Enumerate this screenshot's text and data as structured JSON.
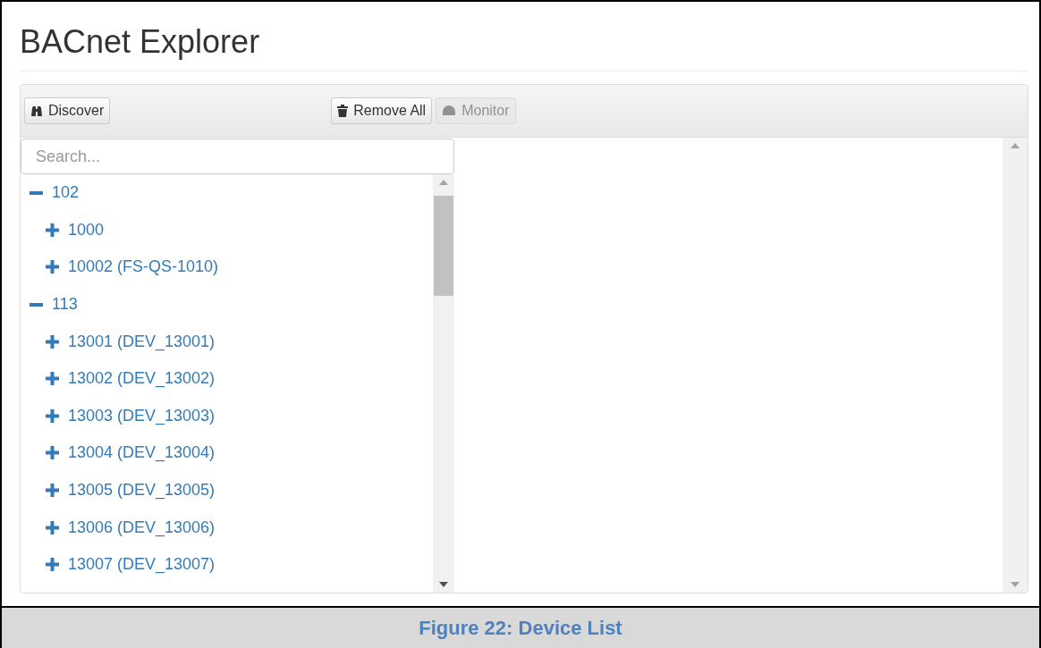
{
  "page_title": "BACnet Explorer",
  "toolbar": {
    "left": [
      {
        "label": "Discover",
        "kind": "binoculars",
        "disabled": false
      }
    ],
    "right": [
      {
        "label": "Remove All",
        "kind": "trash",
        "disabled": false
      },
      {
        "label": "Monitor",
        "kind": "gauge",
        "disabled": true
      }
    ]
  },
  "search": {
    "placeholder": "Search..."
  },
  "tree": [
    {
      "label": "102",
      "expanded": true,
      "children": [
        {
          "label": "1000",
          "expanded": false
        },
        {
          "label": "10002 (FS-QS-1010)",
          "expanded": false
        }
      ]
    },
    {
      "label": "113",
      "expanded": true,
      "children": [
        {
          "label": "13001 (DEV_13001)",
          "expanded": false
        },
        {
          "label": "13002 (DEV_13002)",
          "expanded": false
        },
        {
          "label": "13003 (DEV_13003)",
          "expanded": false
        },
        {
          "label": "13004 (DEV_13004)",
          "expanded": false
        },
        {
          "label": "13005 (DEV_13005)",
          "expanded": false
        },
        {
          "label": "13006 (DEV_13006)",
          "expanded": false
        },
        {
          "label": "13007 (DEV_13007)",
          "expanded": false
        }
      ]
    }
  ],
  "caption": "Figure 22: Device List"
}
